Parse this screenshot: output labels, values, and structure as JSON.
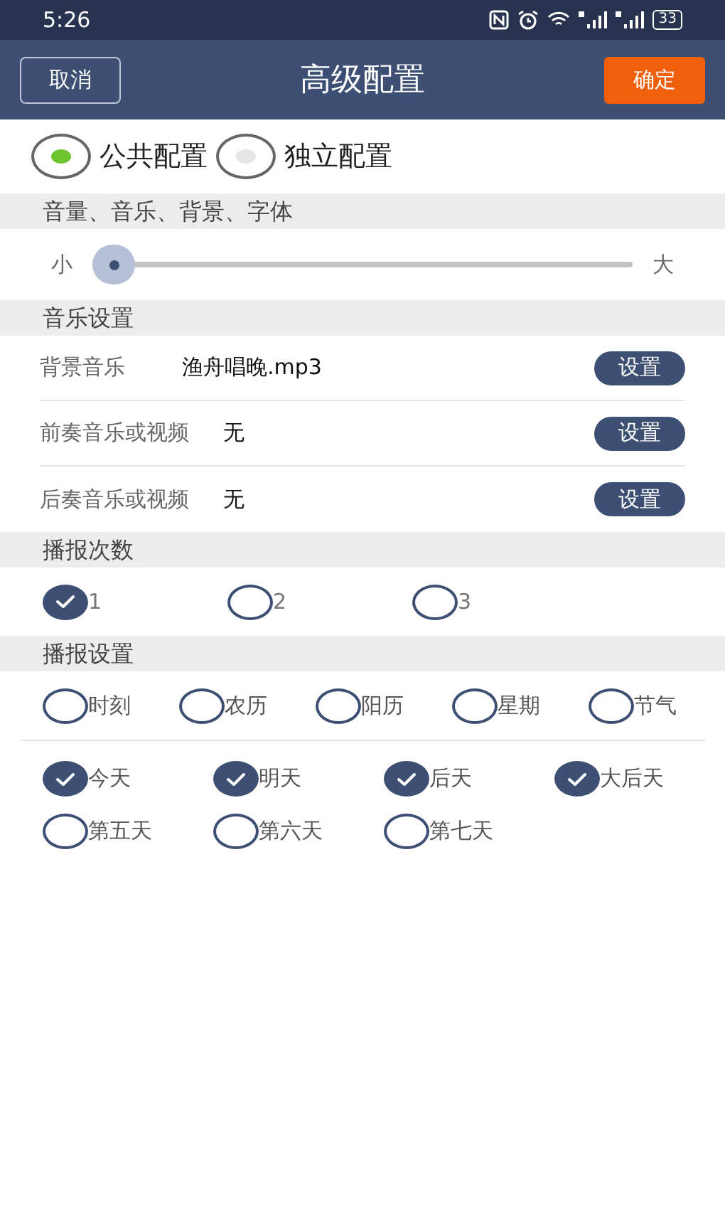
{
  "status_bar": {
    "time": "5:26",
    "battery": "33"
  },
  "header": {
    "cancel": "取消",
    "title": "高级配置",
    "confirm": "确定"
  },
  "modes": [
    {
      "label": "公共配置",
      "selected": true
    },
    {
      "label": "独立配置",
      "selected": false
    }
  ],
  "volume_section": {
    "title": "音量、音乐、背景、字体",
    "min_label": "小",
    "max_label": "大"
  },
  "music_section": {
    "title": "音乐设置",
    "rows": [
      {
        "label": "背景音乐",
        "value": "渔舟唱晚.mp3",
        "button": "设置"
      },
      {
        "label": "前奏音乐或视频",
        "value": "无",
        "button": "设置"
      },
      {
        "label": "后奏音乐或视频",
        "value": "无",
        "button": "设置"
      }
    ]
  },
  "count_section": {
    "title": "播报次数",
    "options": [
      {
        "label": "1",
        "selected": true
      },
      {
        "label": "2",
        "selected": false
      },
      {
        "label": "3",
        "selected": false
      }
    ]
  },
  "broadcast_section": {
    "title": "播报设置",
    "items": [
      {
        "label": "时刻",
        "checked": false
      },
      {
        "label": "农历",
        "checked": false
      },
      {
        "label": "阳历",
        "checked": false
      },
      {
        "label": "星期",
        "checked": false
      },
      {
        "label": "节气",
        "checked": false
      }
    ],
    "days": [
      {
        "label": "今天",
        "checked": true
      },
      {
        "label": "明天",
        "checked": true
      },
      {
        "label": "后天",
        "checked": true
      },
      {
        "label": "大后天",
        "checked": true
      },
      {
        "label": "第五天",
        "checked": false
      },
      {
        "label": "第六天",
        "checked": false
      },
      {
        "label": "第七天",
        "checked": false
      }
    ]
  }
}
